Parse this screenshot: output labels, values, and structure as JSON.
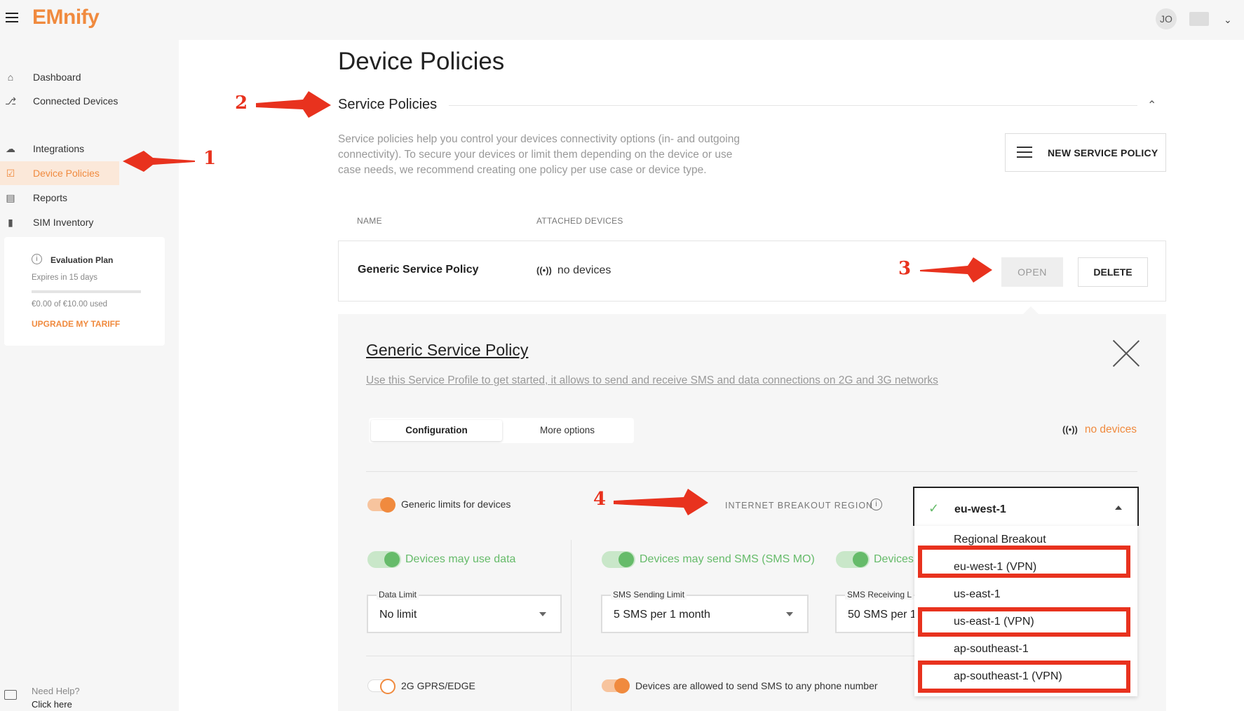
{
  "app": {
    "logo": "EMnify",
    "user_initials": "JO"
  },
  "sidebar": {
    "items": [
      {
        "label": "Dashboard",
        "icon": "home-icon"
      },
      {
        "label": "Connected Devices",
        "icon": "network-icon"
      },
      {
        "label": "Integrations",
        "icon": "cloud-icon"
      },
      {
        "label": "Device Policies",
        "icon": "checkbox-icon",
        "active": true
      },
      {
        "label": "Reports",
        "icon": "chart-icon"
      },
      {
        "label": "SIM Inventory",
        "icon": "sim-icon"
      }
    ],
    "plan": {
      "title": "Evaluation Plan",
      "expires": "Expires in 15 days",
      "used": "€0.00 of €10.00 used",
      "used_fraction": 0.0,
      "upgrade": "UPGRADE MY TARIFF"
    },
    "help": {
      "line1": "Need Help?",
      "line2": "Click here"
    }
  },
  "main": {
    "page_title": "Device Policies",
    "section_title": "Service Policies",
    "description": "Service policies help you control your devices connectivity options (in- and outgoing connectivity). To secure your devices or limit them depending on the device or use case needs, we recommend creating one policy per use case or device type.",
    "new_policy_label": "NEW SERVICE POLICY",
    "table": {
      "headers": [
        "NAME",
        "ATTACHED DEVICES"
      ],
      "rows": [
        {
          "name": "Generic Service Policy",
          "devices": "no devices",
          "open": "OPEN",
          "delete": "DELETE"
        }
      ]
    }
  },
  "details": {
    "title": "Generic Service Policy",
    "description": "Use this Service Profile to get started, it allows to send and receive SMS and data connections on 2G and 3G networks",
    "tabs": [
      "Configuration",
      "More options"
    ],
    "devices": "no devices",
    "generic_limits_label": "Generic limits for devices",
    "region_label": "INTERNET BREAKOUT REGION",
    "data_toggle": "Devices may use data",
    "sms_mo_toggle": "Devices may send SMS (SMS MO)",
    "sms_mt_toggle": "Devices",
    "data_limit": {
      "label": "Data Limit",
      "value": "No limit"
    },
    "sms_send_limit": {
      "label": "SMS Sending Limit",
      "value": "5 SMS per 1 month"
    },
    "sms_recv_limit": {
      "label": "SMS Receiving L",
      "value": "50 SMS per 1"
    },
    "gprs_label": "2G GPRS/EDGE",
    "sms_any_label": "Devices are allowed to send SMS to any phone number"
  },
  "region_dropdown": {
    "selected": "eu-west-1",
    "options": [
      "Regional Breakout",
      "eu-west-1 (VPN)",
      "us-east-1",
      "us-east-1 (VPN)",
      "ap-southeast-1",
      "ap-southeast-1 (VPN)"
    ]
  },
  "annotations": [
    "1",
    "2",
    "3",
    "4"
  ],
  "colors": {
    "accent": "#f08a3e",
    "green": "#66bb6a",
    "annotation": "#e8321e"
  }
}
